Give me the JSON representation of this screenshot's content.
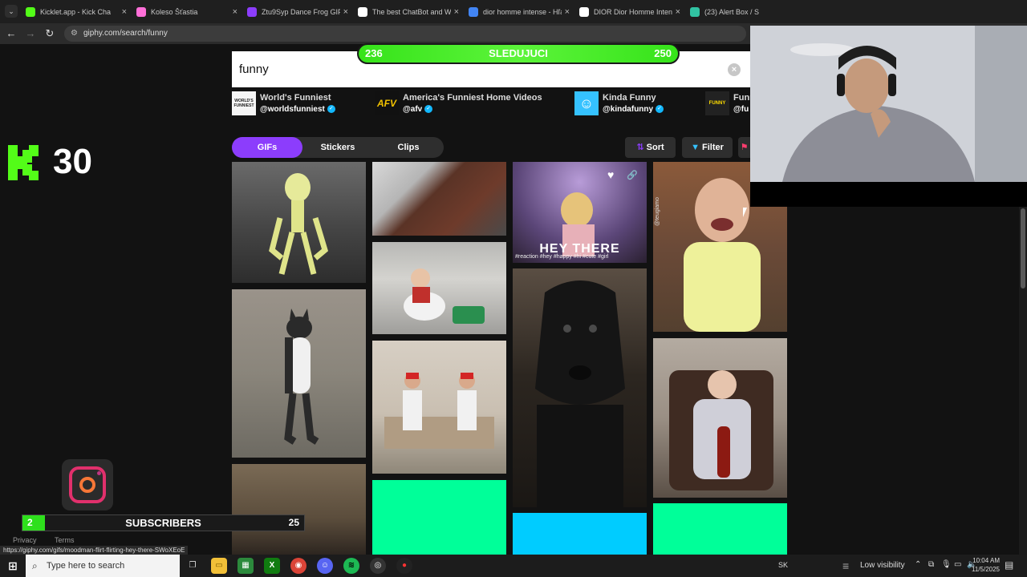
{
  "browser": {
    "tabs": [
      {
        "title": "Kicklet.app - Kick Cha",
        "favicon_color": "#53fc18",
        "active": false
      },
      {
        "title": "Koleso Šťastia",
        "favicon_color": "#ff6fd8",
        "active": false
      },
      {
        "title": "Ztu9Syp Dance Frog GIF -",
        "favicon_color": "#8c3dfc",
        "active": false
      },
      {
        "title": "The best ChatBot and Wi",
        "favicon_color": "#ffffff",
        "active": false
      },
      {
        "title": "dior homme intense - Hľa",
        "favicon_color": "#4285f4",
        "active": false
      },
      {
        "title": "DIOR Dior Homme Intens",
        "favicon_color": "#ffffff",
        "active": false
      },
      {
        "title": "(23) Alert Box / S",
        "favicon_color": "#31c3a2",
        "active": false
      }
    ],
    "url": "giphy.com/search/funny",
    "status_url": "https://giphy.com/gifs/moodman-flirt-flirting-hey-there-SWoXEoE"
  },
  "giphy": {
    "search_value": "funny",
    "channels": [
      {
        "name": "World's Funniest",
        "handle": "@worldsfunniest",
        "logo_text": "WORLD'S FUNNIEST",
        "logo_bg": "#f5f5f5",
        "logo_fg": "#222"
      },
      {
        "name": "America's Funniest Home Videos",
        "handle": "@afv",
        "logo_text": "AFV",
        "logo_bg": "#111",
        "logo_fg": "#f2c200"
      },
      {
        "name": "Kinda Funny",
        "handle": "@kindafunny",
        "logo_text": "☺",
        "logo_bg": "#35c2ff",
        "logo_fg": "#fff"
      },
      {
        "name": "Funn",
        "handle": "@fu",
        "logo_text": "FUNNY",
        "logo_bg": "#222",
        "logo_fg": "#ffde00"
      }
    ],
    "content_tabs": [
      "GIFs",
      "Stickers",
      "Clips"
    ],
    "sort_label": "Sort",
    "filter_label": "Filter",
    "gif_caption": "HEY THERE",
    "gif_hashtags": "#reaction #hey #happy #hi #cute #girl",
    "gif_watermark": "@teugiamo",
    "footer_links": [
      "Privacy",
      "Terms"
    ]
  },
  "overlays": {
    "goal_left": "236",
    "goal_label": "SLEDUJUCI",
    "goal_right": "250",
    "kick_count": "30",
    "sub_left": "2",
    "sub_label": "SUBSCRIBERS",
    "sub_right": "25",
    "sub_progress": 0.08
  },
  "taskbar": {
    "search_placeholder": "Type here to search",
    "lang": "SK",
    "weather": "Low visibility",
    "time": "10:04 AM",
    "date": "11/5/2025"
  }
}
